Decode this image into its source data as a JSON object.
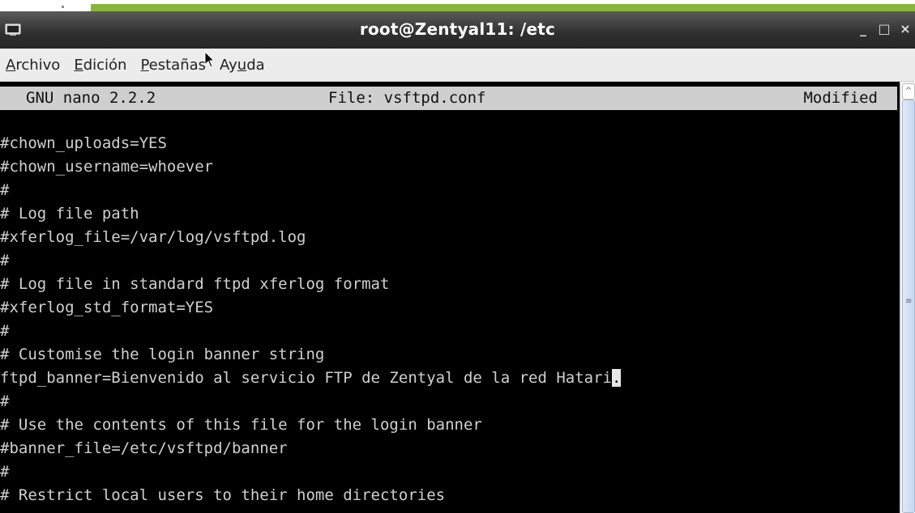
{
  "window": {
    "title": "root@Zentyal11: /etc",
    "controls": {
      "minimize": "_",
      "maximize": "□",
      "close": "×"
    }
  },
  "menu": [
    {
      "pre": "",
      "u": "A",
      "post": "rchivo"
    },
    {
      "pre": "",
      "u": "E",
      "post": "dición"
    },
    {
      "pre": "",
      "u": "P",
      "post": "estañas"
    },
    {
      "pre": "Ay",
      "u": "u",
      "post": "da"
    }
  ],
  "nano": {
    "version": "GNU nano 2.2.2",
    "file": "File: vsftpd.conf",
    "status": "Modified"
  },
  "lines": [
    "#chown_uploads=YES",
    "#chown_username=whoever",
    "#",
    "# Log file path",
    "#xferlog_file=/var/log/vsftpd.log",
    "#",
    "# Log file in standard ftpd xferlog format",
    "#xferlog_std_format=YES",
    "#",
    "# Customise the login banner string",
    "ftpd_banner=Bienvenido al servicio FTP de Zentyal de la red Hatari",
    "#",
    "# Use the contents of this file for the login banner",
    "#banner_file=/etc/vsftpd/banner",
    "#",
    "# Restrict local users to their home directories"
  ],
  "cursor_char": ".",
  "icons": {
    "app": "terminal-icon",
    "pointer": "mouse-pointer-icon"
  },
  "colors": {
    "terminal_bg": "#000000",
    "terminal_fg": "#d0d0d0",
    "header_bg": "#cfcfcf",
    "accent_green": "#8cb43b"
  }
}
